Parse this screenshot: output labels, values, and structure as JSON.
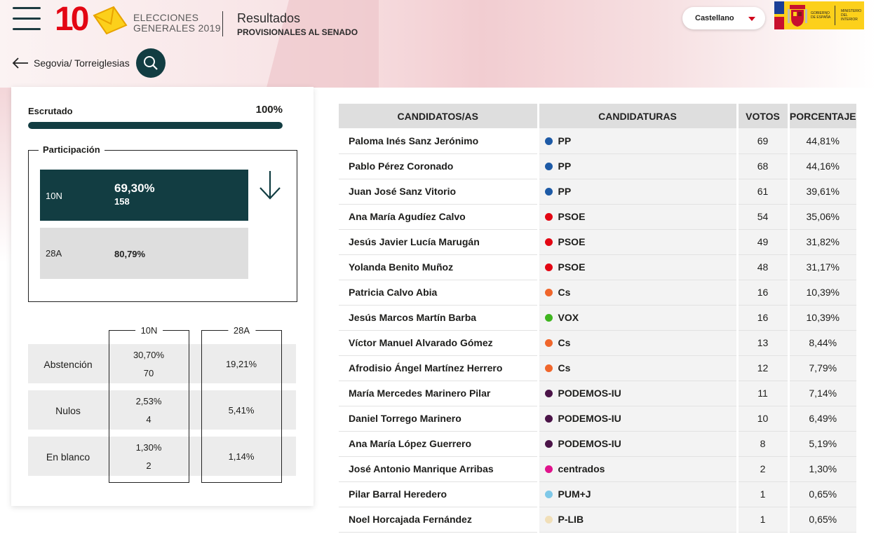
{
  "header": {
    "logo_number": "10",
    "logo_line1": "ELECCIONES",
    "logo_line2": "GENERALES 2019",
    "title": "Resultados",
    "subtitle": "PROVISIONALES AL SENADO",
    "language": "Castellano",
    "gov_text_left": "GOBIERNO DE ESPAÑA",
    "gov_text_right": "MINISTERIO DEL INTERIOR"
  },
  "breadcrumb": {
    "path": "Segovia/ Torreiglesias"
  },
  "escrutado": {
    "label": "Escrutado",
    "value": "100%",
    "progress": 1.0
  },
  "participacion": {
    "legend": "Participación",
    "current": {
      "label": "10N",
      "value": "69,30%",
      "count": "158"
    },
    "previous": {
      "label": "28A",
      "value": "80,79%"
    }
  },
  "stats": {
    "col1": "10N",
    "col2": "28A",
    "rows": [
      {
        "label": "Abstención",
        "v10n": "30,70%",
        "c10n": "70",
        "v28a": "19,21%"
      },
      {
        "label": "Nulos",
        "v10n": "2,53%",
        "c10n": "4",
        "v28a": "5,41%"
      },
      {
        "label": "En blanco",
        "v10n": "1,30%",
        "c10n": "2",
        "v28a": "1,14%"
      }
    ]
  },
  "results": {
    "headers": [
      "CANDIDATOS/AS",
      "CANDIDATURAS",
      "VOTOS",
      "PORCENTAJE"
    ],
    "rows": [
      {
        "candidate": "Paloma Inés Sanz Jerónimo",
        "party": "PP",
        "color": "#1d5aa6",
        "votes": "69",
        "pct": "44,81%"
      },
      {
        "candidate": "Pablo Pérez Coronado",
        "party": "PP",
        "color": "#1d5aa6",
        "votes": "68",
        "pct": "44,16%"
      },
      {
        "candidate": "Juan José Sanz Vitorio",
        "party": "PP",
        "color": "#1d5aa6",
        "votes": "61",
        "pct": "39,61%"
      },
      {
        "candidate": "Ana María Agudíez Calvo",
        "party": "PSOE",
        "color": "#e30613",
        "votes": "54",
        "pct": "35,06%"
      },
      {
        "candidate": "Jesús Javier Lucía Marugán",
        "party": "PSOE",
        "color": "#e30613",
        "votes": "49",
        "pct": "31,82%"
      },
      {
        "candidate": "Yolanda Benito Muñoz",
        "party": "PSOE",
        "color": "#e30613",
        "votes": "48",
        "pct": "31,17%"
      },
      {
        "candidate": "Patricia Calvo Abia",
        "party": "Cs",
        "color": "#f0662b",
        "votes": "16",
        "pct": "10,39%"
      },
      {
        "candidate": "Jesús Marcos Martín Barba",
        "party": "VOX",
        "color": "#3fb51f",
        "votes": "16",
        "pct": "10,39%"
      },
      {
        "candidate": "Víctor Manuel Alvarado Gómez",
        "party": "Cs",
        "color": "#f0662b",
        "votes": "13",
        "pct": "8,44%"
      },
      {
        "candidate": "Afrodisio Ángel Martínez Herrero",
        "party": "Cs",
        "color": "#f0662b",
        "votes": "12",
        "pct": "7,79%"
      },
      {
        "candidate": "María Mercedes Marinero Pilar",
        "party": "PODEMOS-IU",
        "color": "#4b1448",
        "votes": "11",
        "pct": "7,14%"
      },
      {
        "candidate": "Daniel Torrego Marinero",
        "party": "PODEMOS-IU",
        "color": "#4b1448",
        "votes": "10",
        "pct": "6,49%"
      },
      {
        "candidate": "Ana María López Guerrero",
        "party": "PODEMOS-IU",
        "color": "#4b1448",
        "votes": "8",
        "pct": "5,19%"
      },
      {
        "candidate": "José Antonio Manrique Arribas",
        "party": "centrados",
        "color": "#e0138c",
        "votes": "2",
        "pct": "1,30%"
      },
      {
        "candidate": "Pilar Barral Heredero",
        "party": "PUM+J",
        "color": "#7ec8e8",
        "votes": "1",
        "pct": "0,65%"
      },
      {
        "candidate": "Noel Horcajada Fernández",
        "party": "P-LIB",
        "color": "#f1dfb8",
        "votes": "1",
        "pct": "0,65%"
      }
    ]
  }
}
